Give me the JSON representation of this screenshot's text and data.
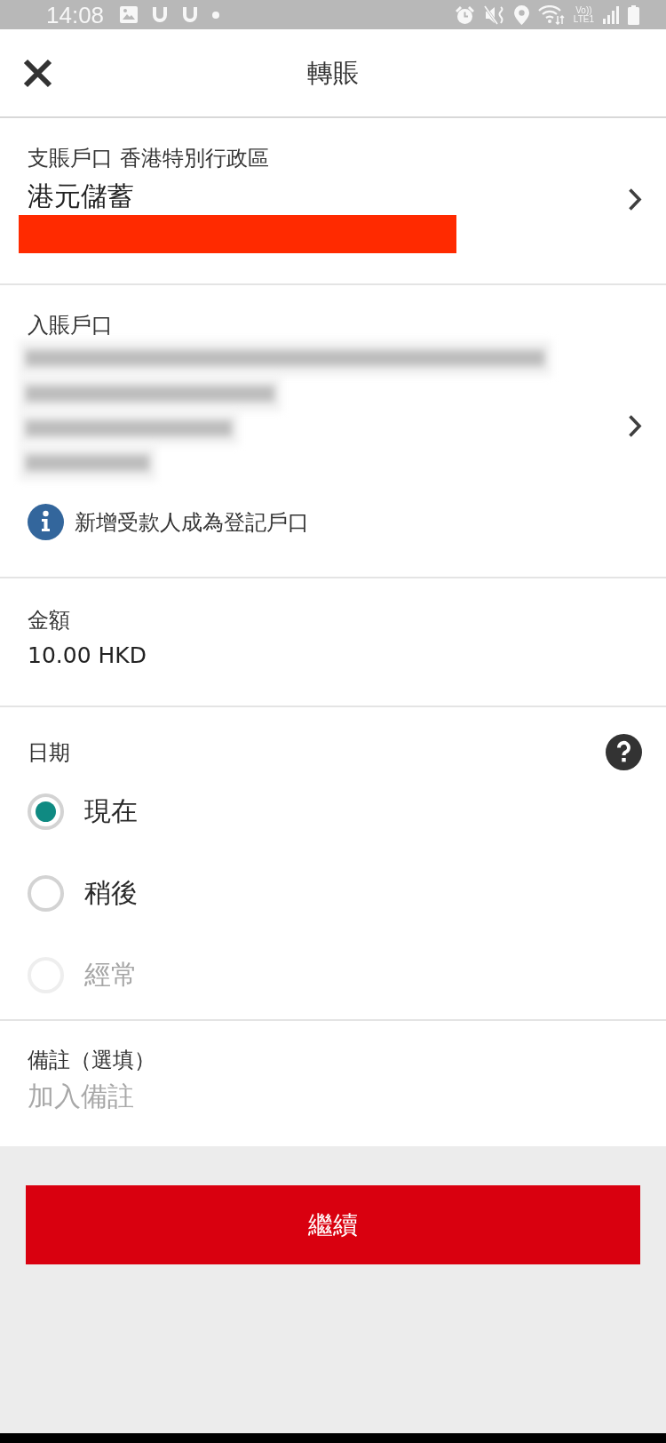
{
  "status_bar": {
    "time": "14:08",
    "volte": "Vo))",
    "network": "LTE1"
  },
  "header": {
    "title": "轉賬"
  },
  "from_account": {
    "label": "支賬戶口 香港特別行政區",
    "account_name": "港元儲蓄",
    "redacted": true
  },
  "to_account": {
    "label": "入賬戶口",
    "redacted_lines": [
      {
        "kind": "blurred"
      },
      {
        "kind": "blurred"
      },
      {
        "kind": "blurred"
      },
      {
        "kind": "blurred"
      }
    ],
    "notice": "新增受款人成為登記戶口"
  },
  "amount": {
    "label": "金額",
    "value": "10.00 HKD"
  },
  "date": {
    "label": "日期",
    "options": [
      {
        "label": "現在",
        "selected": true,
        "disabled": false
      },
      {
        "label": "稍後",
        "selected": false,
        "disabled": false
      },
      {
        "label": "經常",
        "selected": false,
        "disabled": true
      }
    ]
  },
  "remark": {
    "label": "備註（選填）",
    "placeholder": "加入備註"
  },
  "continue_button": {
    "label": "繼續"
  }
}
